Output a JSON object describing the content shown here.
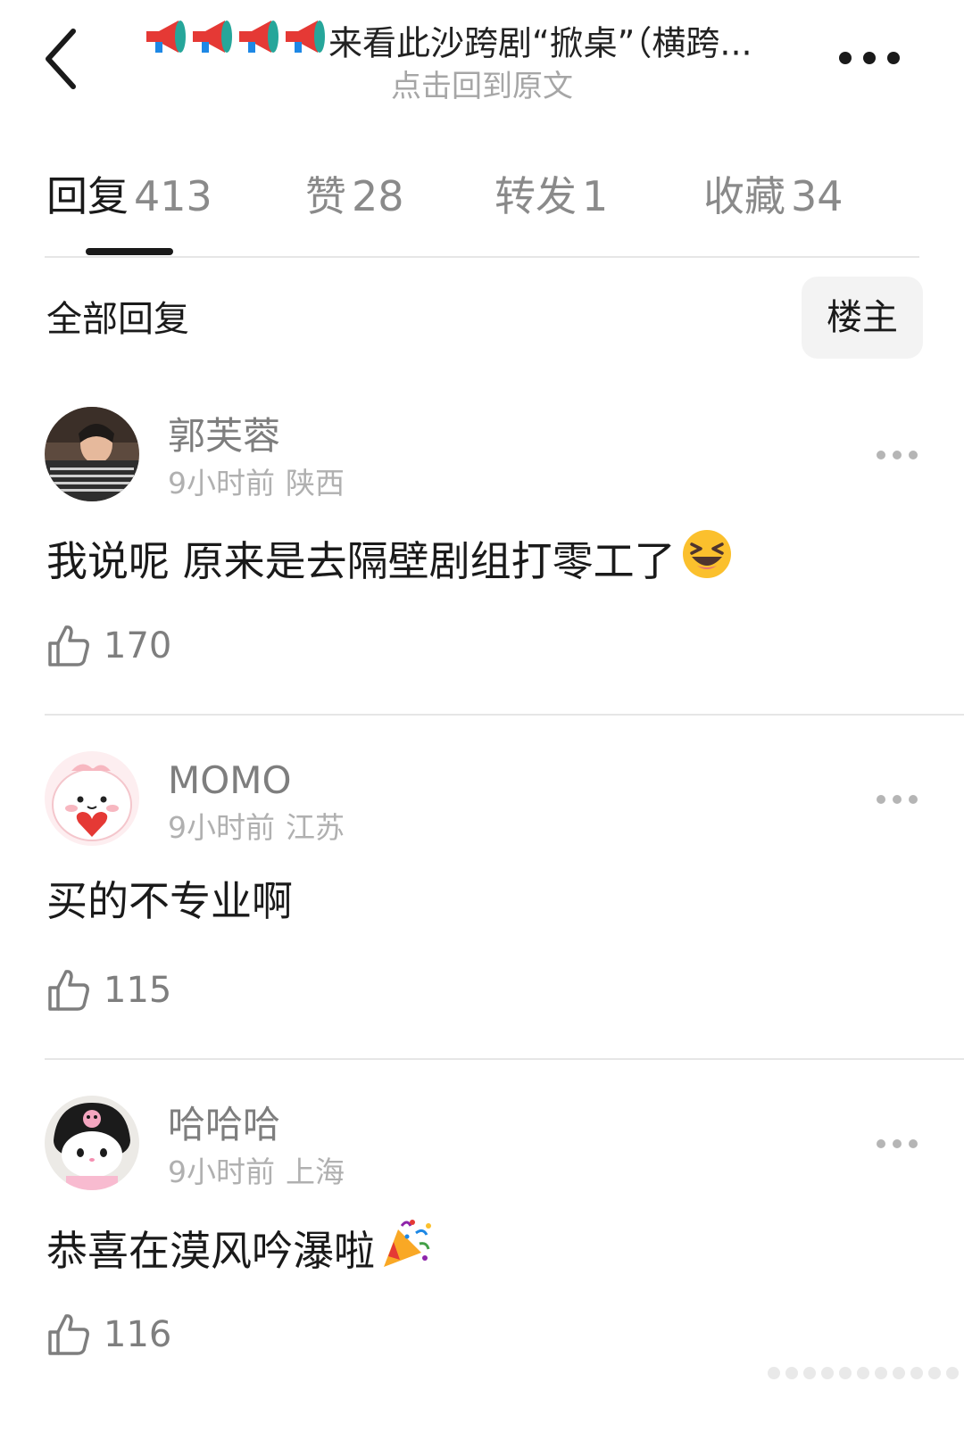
{
  "header": {
    "title": "来看此沙跨剧“掀桌”（横跨...",
    "subtitle": "点击回到原文"
  },
  "tabs": [
    {
      "label": "回复",
      "count": "413"
    },
    {
      "label": "赞",
      "count": "28"
    },
    {
      "label": "转发",
      "count": "1"
    },
    {
      "label": "收藏",
      "count": "34"
    }
  ],
  "filter": {
    "label": "全部回复",
    "op_button": "楼主"
  },
  "comments": [
    {
      "author": "郭芙蓉",
      "time": "9小时前",
      "location": "陕西",
      "text": "我说呢 原来是去隔壁剧组打零工了",
      "emoji": "laughing-emoji",
      "likes": "170"
    },
    {
      "author": "MOMO",
      "time": "9小时前",
      "location": "江苏",
      "text": "买的不专业啊",
      "emoji": "",
      "likes": "115"
    },
    {
      "author": "哈哈哈",
      "time": "9小时前",
      "location": "上海",
      "text": "恭喜在漠风吟瀑啦",
      "emoji": "party-popper-emoji",
      "likes": "116"
    }
  ],
  "icons": {
    "back": "chevron-left-icon",
    "more": "more-icon",
    "megaphone": "megaphone-icon",
    "like": "thumbs-up-icon"
  }
}
